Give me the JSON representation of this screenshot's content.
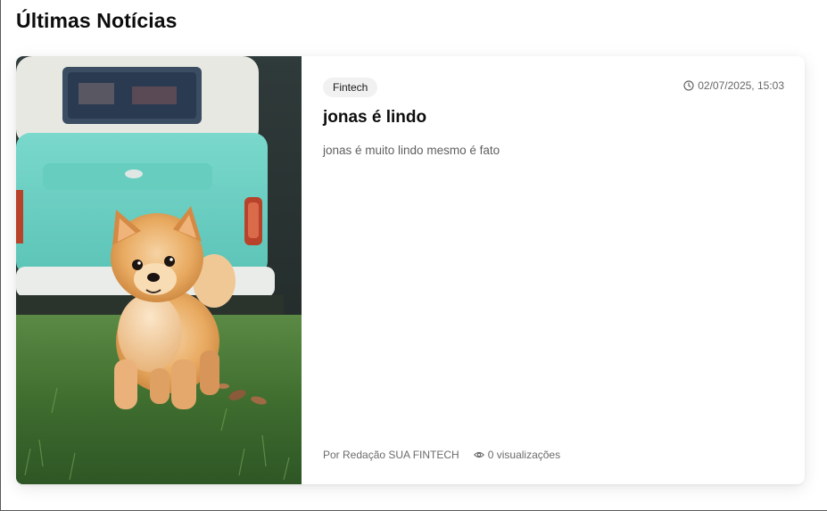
{
  "section": {
    "title": "Últimas Notícias"
  },
  "news_card": {
    "image_icon": "dog-photo",
    "category": "Fintech",
    "date": "02/07/2025, 15:03",
    "title": "jonas é lindo",
    "excerpt": "jonas é muito lindo mesmo é fato",
    "author": "Por Redação SUA FINTECH",
    "views": "0 visualizações"
  },
  "icons": {
    "date": "clock-icon",
    "views": "eye-icon"
  },
  "colors": {
    "van_teal": "#6fd3c7",
    "grass_green": "#4e7d3a",
    "dog_fur": "#e3a055",
    "badge_bg": "#f1f1f1",
    "muted_text": "#666666"
  }
}
